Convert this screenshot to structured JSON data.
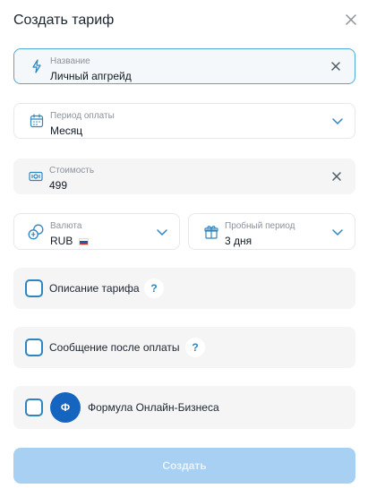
{
  "dialog": {
    "title": "Создать тариф"
  },
  "fields": {
    "name": {
      "label": "Название",
      "value": "Личный апгрейд"
    },
    "period": {
      "label": "Период оплаты",
      "value": "Месяц"
    },
    "price": {
      "label": "Стоимость",
      "value": "499"
    },
    "currency": {
      "label": "Валюта",
      "value": "RUB"
    },
    "trial": {
      "label": "Пробный период",
      "value": "3 дня"
    }
  },
  "options": {
    "description": {
      "label": "Описание тарифа",
      "help": "?"
    },
    "after_payment": {
      "label": "Сообщение после оплаты",
      "help": "?"
    },
    "product": {
      "label": "Формула Онлайн-Бизнеса",
      "avatar": "Ф"
    }
  },
  "buttons": {
    "create": "Создать"
  },
  "colors": {
    "accent": "#2e86c1",
    "avatar": "#1565c0",
    "button_disabled": "#a8d0f2"
  }
}
